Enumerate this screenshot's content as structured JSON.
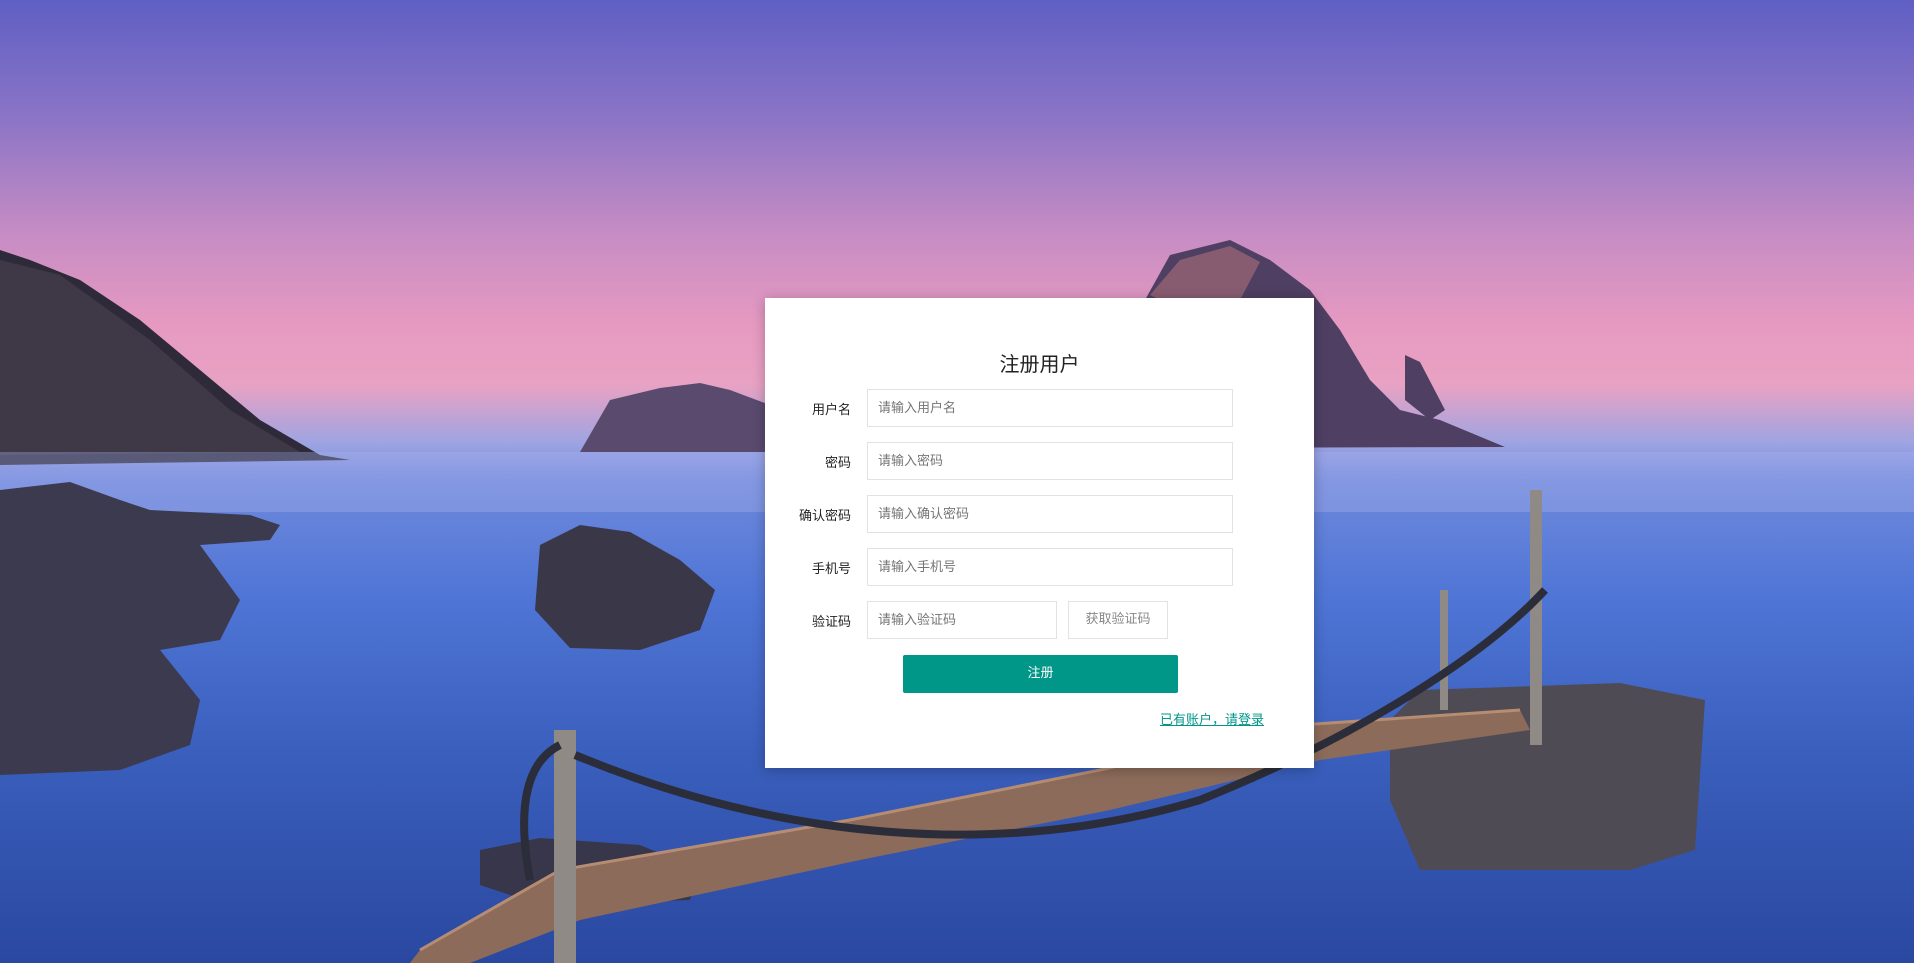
{
  "form": {
    "title": "注册用户",
    "fields": [
      {
        "label": "用户名",
        "placeholder": "请输入用户名"
      },
      {
        "label": "密码",
        "placeholder": "请输入密码"
      },
      {
        "label": "确认密码",
        "placeholder": "请输入确认密码"
      },
      {
        "label": "手机号",
        "placeholder": "请输入手机号"
      },
      {
        "label": "验证码",
        "placeholder": "请输入验证码"
      }
    ],
    "get_code_label": "获取验证码",
    "submit_label": "注册",
    "login_link": "已有账户，请登录"
  },
  "colors": {
    "accent": "#009688",
    "card_bg": "#ffffff"
  }
}
